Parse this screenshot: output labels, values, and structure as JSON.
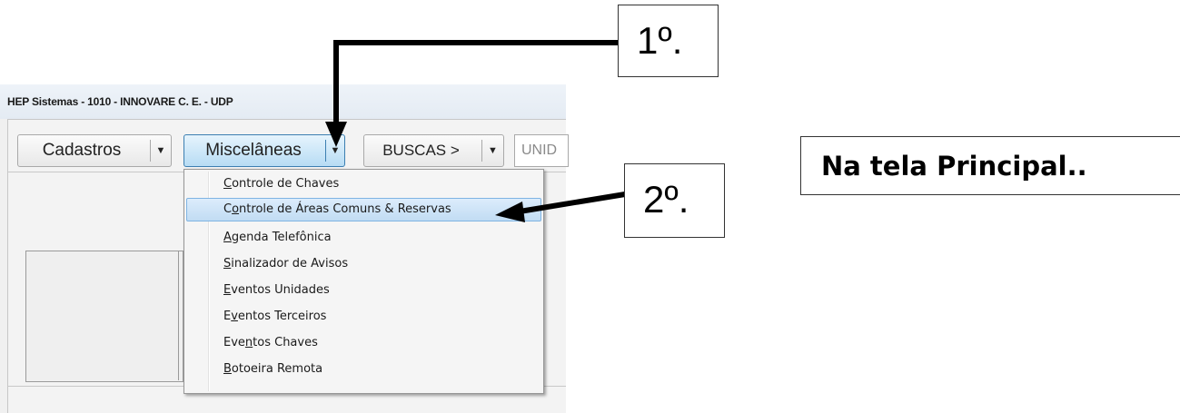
{
  "window": {
    "title": "HEP Sistemas - 1010 - INNOVARE C. E.  -    UDP"
  },
  "toolbar": {
    "cadastros_label": "Cadastros",
    "miscelaneas_label": "Miscelâneas",
    "buscas_label": "BUSCAS >",
    "dropdown_arrow": "▼",
    "unid_placeholder": "UNID"
  },
  "menu": {
    "items": [
      {
        "label": "Controle de Chaves",
        "mnemonic": "C"
      },
      {
        "label": "Controle de Áreas Comuns & Reservas",
        "mnemonic": "o",
        "highlighted": true
      },
      {
        "label": "Agenda Telefônica",
        "mnemonic": "A"
      },
      {
        "label": "Sinalizador de Avisos",
        "mnemonic": "S"
      },
      {
        "label": "Eventos Unidades",
        "mnemonic": "E"
      },
      {
        "label": "Eventos Terceiros",
        "mnemonic": "v"
      },
      {
        "label": "Eventos Chaves",
        "mnemonic": "n"
      },
      {
        "label": "Botoeira Remota",
        "mnemonic": "B"
      }
    ]
  },
  "annotations": {
    "step1": "1º.",
    "step2": "2º.",
    "note": "Na tela Principal.."
  },
  "colors": {
    "highlight": "#c9e2f7",
    "active_button": "#b7dcf4",
    "arrow": "#000000"
  }
}
